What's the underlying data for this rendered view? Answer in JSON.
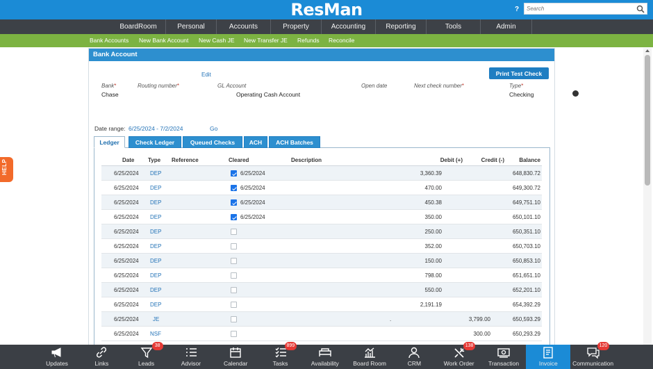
{
  "header": {
    "logo": "ResMan",
    "help_label": "?",
    "search_placeholder": "Search"
  },
  "nav": [
    "BoardRoom",
    "Personal",
    "Accounts",
    "Property",
    "Accounting",
    "Reporting",
    "Tools",
    "Admin"
  ],
  "subnav": [
    "Bank Accounts",
    "New Bank Account",
    "New Cash JE",
    "New Transfer JE",
    "Refunds",
    "Reconcile"
  ],
  "help_tab": "HELP",
  "panel": {
    "title": "Bank Account",
    "edit_label": "Edit",
    "print_test_check": "Print Test Check",
    "fields": {
      "bank_label": "Bank",
      "bank_value": "Chase",
      "routing_label": "Routing number",
      "gl_label": "GL Account",
      "gl_value": "Operating Cash Account",
      "open_date_label": "Open date",
      "next_check_label": "Next check number",
      "type_label": "Type",
      "type_value": "Checking"
    },
    "date_range_label": "Date range:",
    "date_range_value": "6/25/2024 - 7/2/2024",
    "go_label": "Go"
  },
  "tabs": [
    "Ledger",
    "Check Ledger",
    "Queued Checks",
    "ACH",
    "ACH Batches"
  ],
  "ledger": {
    "columns": [
      "Date",
      "Type",
      "Reference",
      "Cleared",
      "Description",
      "Debit (+)",
      "Credit (-)",
      "Balance"
    ],
    "rows": [
      {
        "date": "6/25/2024",
        "type": "DEP",
        "cleared": true,
        "cleared_date": "6/25/2024",
        "description": "",
        "debit": "3,360.39",
        "credit": "",
        "balance": "648,830.72"
      },
      {
        "date": "6/25/2024",
        "type": "DEP",
        "cleared": true,
        "cleared_date": "6/25/2024",
        "description": "",
        "debit": "470.00",
        "credit": "",
        "balance": "649,300.72"
      },
      {
        "date": "6/25/2024",
        "type": "DEP",
        "cleared": true,
        "cleared_date": "6/25/2024",
        "description": "",
        "debit": "450.38",
        "credit": "",
        "balance": "649,751.10"
      },
      {
        "date": "6/25/2024",
        "type": "DEP",
        "cleared": true,
        "cleared_date": "6/25/2024",
        "description": "",
        "debit": "350.00",
        "credit": "",
        "balance": "650,101.10"
      },
      {
        "date": "6/25/2024",
        "type": "DEP",
        "cleared": false,
        "cleared_date": "",
        "description": "",
        "debit": "250.00",
        "credit": "",
        "balance": "650,351.10"
      },
      {
        "date": "6/25/2024",
        "type": "DEP",
        "cleared": false,
        "cleared_date": "",
        "description": "",
        "debit": "352.00",
        "credit": "",
        "balance": "650,703.10"
      },
      {
        "date": "6/25/2024",
        "type": "DEP",
        "cleared": false,
        "cleared_date": "",
        "description": "",
        "debit": "150.00",
        "credit": "",
        "balance": "650,853.10"
      },
      {
        "date": "6/25/2024",
        "type": "DEP",
        "cleared": false,
        "cleared_date": "",
        "description": "",
        "debit": "798.00",
        "credit": "",
        "balance": "651,651.10"
      },
      {
        "date": "6/25/2024",
        "type": "DEP",
        "cleared": false,
        "cleared_date": "",
        "description": "",
        "debit": "550.00",
        "credit": "",
        "balance": "652,201.10"
      },
      {
        "date": "6/25/2024",
        "type": "DEP",
        "cleared": false,
        "cleared_date": "",
        "description": "",
        "debit": "2,191.19",
        "credit": "",
        "balance": "654,392.29"
      },
      {
        "date": "6/25/2024",
        "type": "JE",
        "cleared": false,
        "cleared_date": "",
        "description": ".",
        "debit": "",
        "credit": "3,799.00",
        "balance": "650,593.29"
      },
      {
        "date": "6/25/2024",
        "type": "NSF",
        "cleared": false,
        "cleared_date": "",
        "description": "",
        "debit": "",
        "credit": "300.00",
        "balance": "650,293.29"
      }
    ]
  },
  "taskbar": [
    {
      "label": "Updates",
      "icon": "megaphone-icon",
      "badge": ""
    },
    {
      "label": "Links",
      "icon": "link-icon",
      "badge": ""
    },
    {
      "label": "Leads",
      "icon": "funnel-icon",
      "badge": "38"
    },
    {
      "label": "Advisor",
      "icon": "list-icon",
      "badge": ""
    },
    {
      "label": "Calendar",
      "icon": "calendar-icon",
      "badge": ""
    },
    {
      "label": "Tasks",
      "icon": "checklist-icon",
      "badge": "899"
    },
    {
      "label": "Availability",
      "icon": "bed-icon",
      "badge": ""
    },
    {
      "label": "Board Room",
      "icon": "bar-chart-icon",
      "badge": ""
    },
    {
      "label": "CRM",
      "icon": "person-icon",
      "badge": ""
    },
    {
      "label": "Work Order",
      "icon": "tools-icon",
      "badge": "138"
    },
    {
      "label": "Transaction",
      "icon": "money-icon",
      "badge": ""
    },
    {
      "label": "Invoice",
      "icon": "invoice-icon",
      "badge": ""
    },
    {
      "label": "Communication",
      "icon": "chat-icon",
      "badge": "120"
    }
  ],
  "colors": {
    "header": "#1b8bd6",
    "nav": "#3d4147",
    "subnav": "#7cb342",
    "panel_title": "#2d8fcf",
    "help": "#f26a2a",
    "badge": "#e53935"
  }
}
